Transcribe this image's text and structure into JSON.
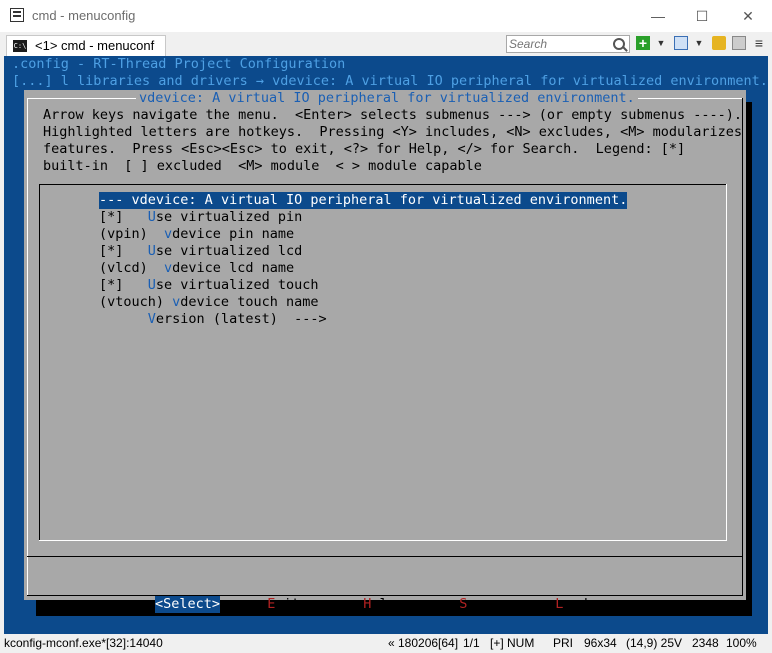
{
  "window": {
    "title": "cmd - menuconfig",
    "controls": {
      "minimize": "—",
      "maximize": "☐",
      "close": "✕"
    }
  },
  "tabs": [
    {
      "label": "<1> cmd - menuconf",
      "icon": "console-icon",
      "icon_text": "C:\\"
    }
  ],
  "search": {
    "placeholder": "Search"
  },
  "toolbar": {
    "icons": [
      "search-icon",
      "add-icon",
      "dropdown-icon",
      "window-layout-icon",
      "dropdown-icon",
      "lock-icon",
      "panel-icon",
      "hamburger-menu-icon"
    ],
    "add_glyph": "+",
    "arrow_glyph": "▼",
    "menu_glyph": "≡"
  },
  "console": {
    "header_line1": ".config - RT-Thread Project Configuration",
    "header_line2": "[...] l libraries and drivers → vdevice: A virtual IO peripheral for virtualized environment.",
    "dialog_title": "vdevice: A virtual IO peripheral for virtualized environment.",
    "help_lines": [
      "Arrow keys navigate the menu.  <Enter> selects submenus ---> (or empty submenus ----).",
      "Highlighted letters are hotkeys.  Pressing <Y> includes, <N> excludes, <M> modularizes",
      "features.  Press <Esc><Esc> to exit, <?> for Help, </> for Search.  Legend: [*]",
      "built-in  [ ] excluded  <M> module  < > module capable"
    ],
    "menu_items": [
      {
        "prefix": "-",
        "hotkey": "-",
        "rest": "- vdevice: A virtual IO peripheral for virtualized environment.",
        "selected": true
      },
      {
        "prefix": "[*]   ",
        "hotkey": "U",
        "rest": "se virtualized pin",
        "selected": false
      },
      {
        "prefix": "(vpin)  ",
        "hotkey": "v",
        "rest": "device pin name",
        "selected": false
      },
      {
        "prefix": "[*]   ",
        "hotkey": "U",
        "rest": "se virtualized lcd",
        "selected": false
      },
      {
        "prefix": "(vlcd)  ",
        "hotkey": "v",
        "rest": "device lcd name",
        "selected": false
      },
      {
        "prefix": "[*]   ",
        "hotkey": "U",
        "rest": "se virtualized touch",
        "selected": false
      },
      {
        "prefix": "(vtouch) ",
        "hotkey": "v",
        "rest": "device touch name",
        "selected": false
      },
      {
        "prefix": "      ",
        "hotkey": "V",
        "rest": "ersion (latest)  --->",
        "selected": false
      }
    ],
    "buttons": [
      {
        "open": "<",
        "hotkey": "S",
        "rest": "elect",
        "close": ">",
        "selected": true
      },
      {
        "open": "< ",
        "hotkey": "E",
        "rest": "xit",
        "close": " >",
        "selected": false
      },
      {
        "open": "< ",
        "hotkey": "H",
        "rest": "elp",
        "close": " >",
        "selected": false
      },
      {
        "open": "< ",
        "hotkey": "S",
        "rest": "ave",
        "close": " >",
        "selected": false
      },
      {
        "open": "< ",
        "hotkey": "L",
        "rest": "oad",
        "close": " >",
        "selected": false
      }
    ]
  },
  "statusbar": {
    "process": "kconfig-mconf.exe*[32]:14040",
    "position": "« 180206[64]",
    "page": "1/1",
    "insert": "[+] NUM",
    "priority": "PRI",
    "size": "96x34",
    "cursor": "(14,9) 25V",
    "pid": "2348",
    "zoom": "100%"
  },
  "colors": {
    "console_bg": "#0c4a8c",
    "dialog_bg": "#a8a8a8",
    "hotkey_blue": "#1a5fb4",
    "hotkey_red": "#b22222",
    "header_text": "#4ea0e4"
  }
}
